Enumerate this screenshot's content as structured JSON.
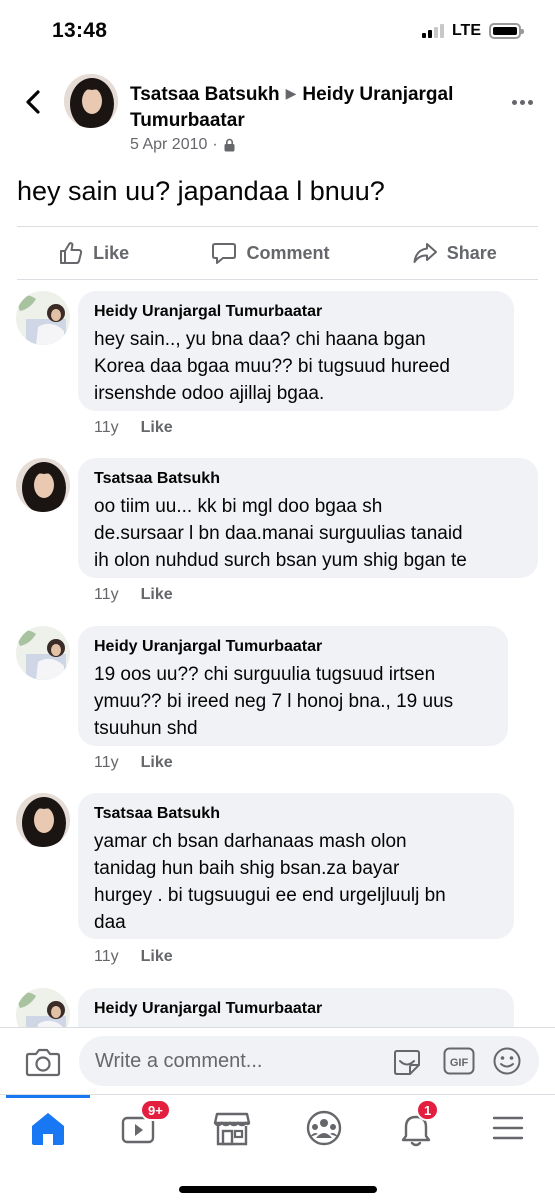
{
  "status_bar": {
    "time": "13:48",
    "network": "LTE"
  },
  "post": {
    "author": "Tsatsaa Batsukh",
    "recipient": "Heidy Uranjargal Tumurbaatar",
    "date": "5 Apr 2010",
    "separator": "·",
    "privacy_icon": "lock-icon",
    "text": "hey sain uu? japandaa l bnuu?"
  },
  "actions": {
    "like": "Like",
    "comment": "Comment",
    "share": "Share"
  },
  "comments": [
    {
      "author": "Heidy Uranjargal Tumurbaatar",
      "lines": [
        "hey sain.., yu bna daa? chi haana bgan",
        "Korea daa bgaa muu?? bi tugsuud hureed",
        "irsenshde odoo ajillaj bgaa."
      ],
      "age": "11y",
      "like": "Like"
    },
    {
      "author": "Tsatsaa Batsukh",
      "lines": [
        "oo tiim uu... kk bi mgl doo bgaa sh",
        "de.sursaar l bn daa.manai surguulias tanaid",
        "ih olon nuhdud surch bsan yum shig bgan te"
      ],
      "age": "11y",
      "like": "Like"
    },
    {
      "author": "Heidy Uranjargal Tumurbaatar",
      "lines": [
        "19 oos uu?? chi surguulia tugsuud irtsen",
        "ymuu?? bi ireed neg 7 l honoj bna., 19 uus",
        "tsuuhun shd"
      ],
      "age": "11y",
      "like": "Like"
    },
    {
      "author": "Tsatsaa Batsukh",
      "lines": [
        "yamar ch bsan darhanaas mash olon",
        "tanidag hun baih shig bsan.za bayar",
        "hurgey . bi tugsuugui ee end urgeljluulj bn",
        "daa"
      ],
      "age": "11y",
      "like": "Like"
    },
    {
      "author": "Heidy Uranjargal Tumurbaatar",
      "lines": [],
      "age": "",
      "like": ""
    }
  ],
  "composer": {
    "placeholder": "Write a comment..."
  },
  "nav": {
    "active": "home",
    "video_badge": "9+",
    "notifications_badge": "1"
  },
  "colors": {
    "accent": "#1877f2",
    "bubble": "#f0f2f5",
    "muted": "#65676b",
    "badge": "#e41e3f"
  }
}
